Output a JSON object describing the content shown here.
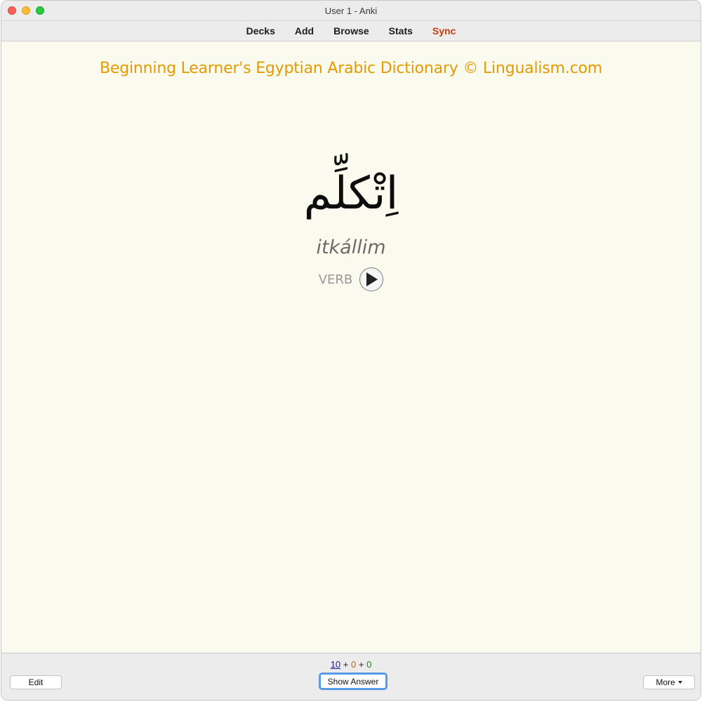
{
  "window": {
    "title": "User 1 - Anki"
  },
  "toolbar": {
    "decks": "Decks",
    "add": "Add",
    "browse": "Browse",
    "stats": "Stats",
    "sync": "Sync"
  },
  "card": {
    "header": "Beginning Learner's Egyptian Arabic Dictionary © Lingualism.com",
    "arabic_word": "اِتْكلِّم",
    "transliteration": "itkállim",
    "part_of_speech": "VERB",
    "play_icon": "play-icon"
  },
  "bottom": {
    "counts": {
      "new": "10",
      "sep1": " + ",
      "learning": "0",
      "sep2": " + ",
      "review": "0"
    },
    "edit_label": "Edit",
    "show_answer_label": "Show Answer",
    "more_label": "More"
  },
  "colors": {
    "header_accent": "#e59a00",
    "sync": "#c83a0a",
    "count_new": "#1a1a9a",
    "count_learning": "#c8610a",
    "count_review": "#1a8a1a",
    "card_background": "#fafaee"
  }
}
